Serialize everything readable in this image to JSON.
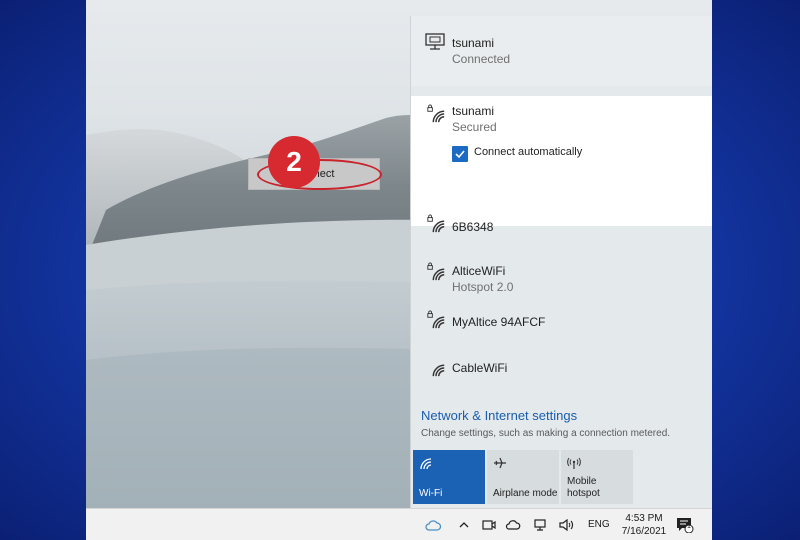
{
  "networks": {
    "connected": {
      "name": "tsunami",
      "status": "Connected"
    },
    "selected": {
      "name": "tsunami",
      "status": "Secured",
      "auto_connect_label": "Connect automatically",
      "auto_connect_checked": true,
      "connect_button": "Connect"
    },
    "list": [
      {
        "name": "6B6348",
        "status": ""
      },
      {
        "name": "AlticeWiFi",
        "status": "Hotspot 2.0"
      },
      {
        "name": "MyAltice 94AFCF",
        "status": ""
      },
      {
        "name": "CableWiFi",
        "status": ""
      }
    ]
  },
  "annotation": {
    "step_number": "2",
    "accent_color": "#d62930"
  },
  "settings": {
    "link_label": "Network & Internet settings",
    "description": "Change settings, such as making a connection metered."
  },
  "quick_actions": [
    {
      "label": "Wi-Fi",
      "icon": "wifi-icon",
      "active": true
    },
    {
      "label": "Airplane mode",
      "icon": "airplane-icon",
      "active": false
    },
    {
      "label": "Mobile hotspot",
      "icon": "hotspot-icon",
      "active": false
    }
  ],
  "taskbar": {
    "language": "ENG",
    "time": "4:53 PM",
    "date": "7/16/2021",
    "notification_count": "1"
  },
  "colors": {
    "accent": "#1b62b4",
    "link": "#1a5dae",
    "annotation": "#d62930"
  }
}
